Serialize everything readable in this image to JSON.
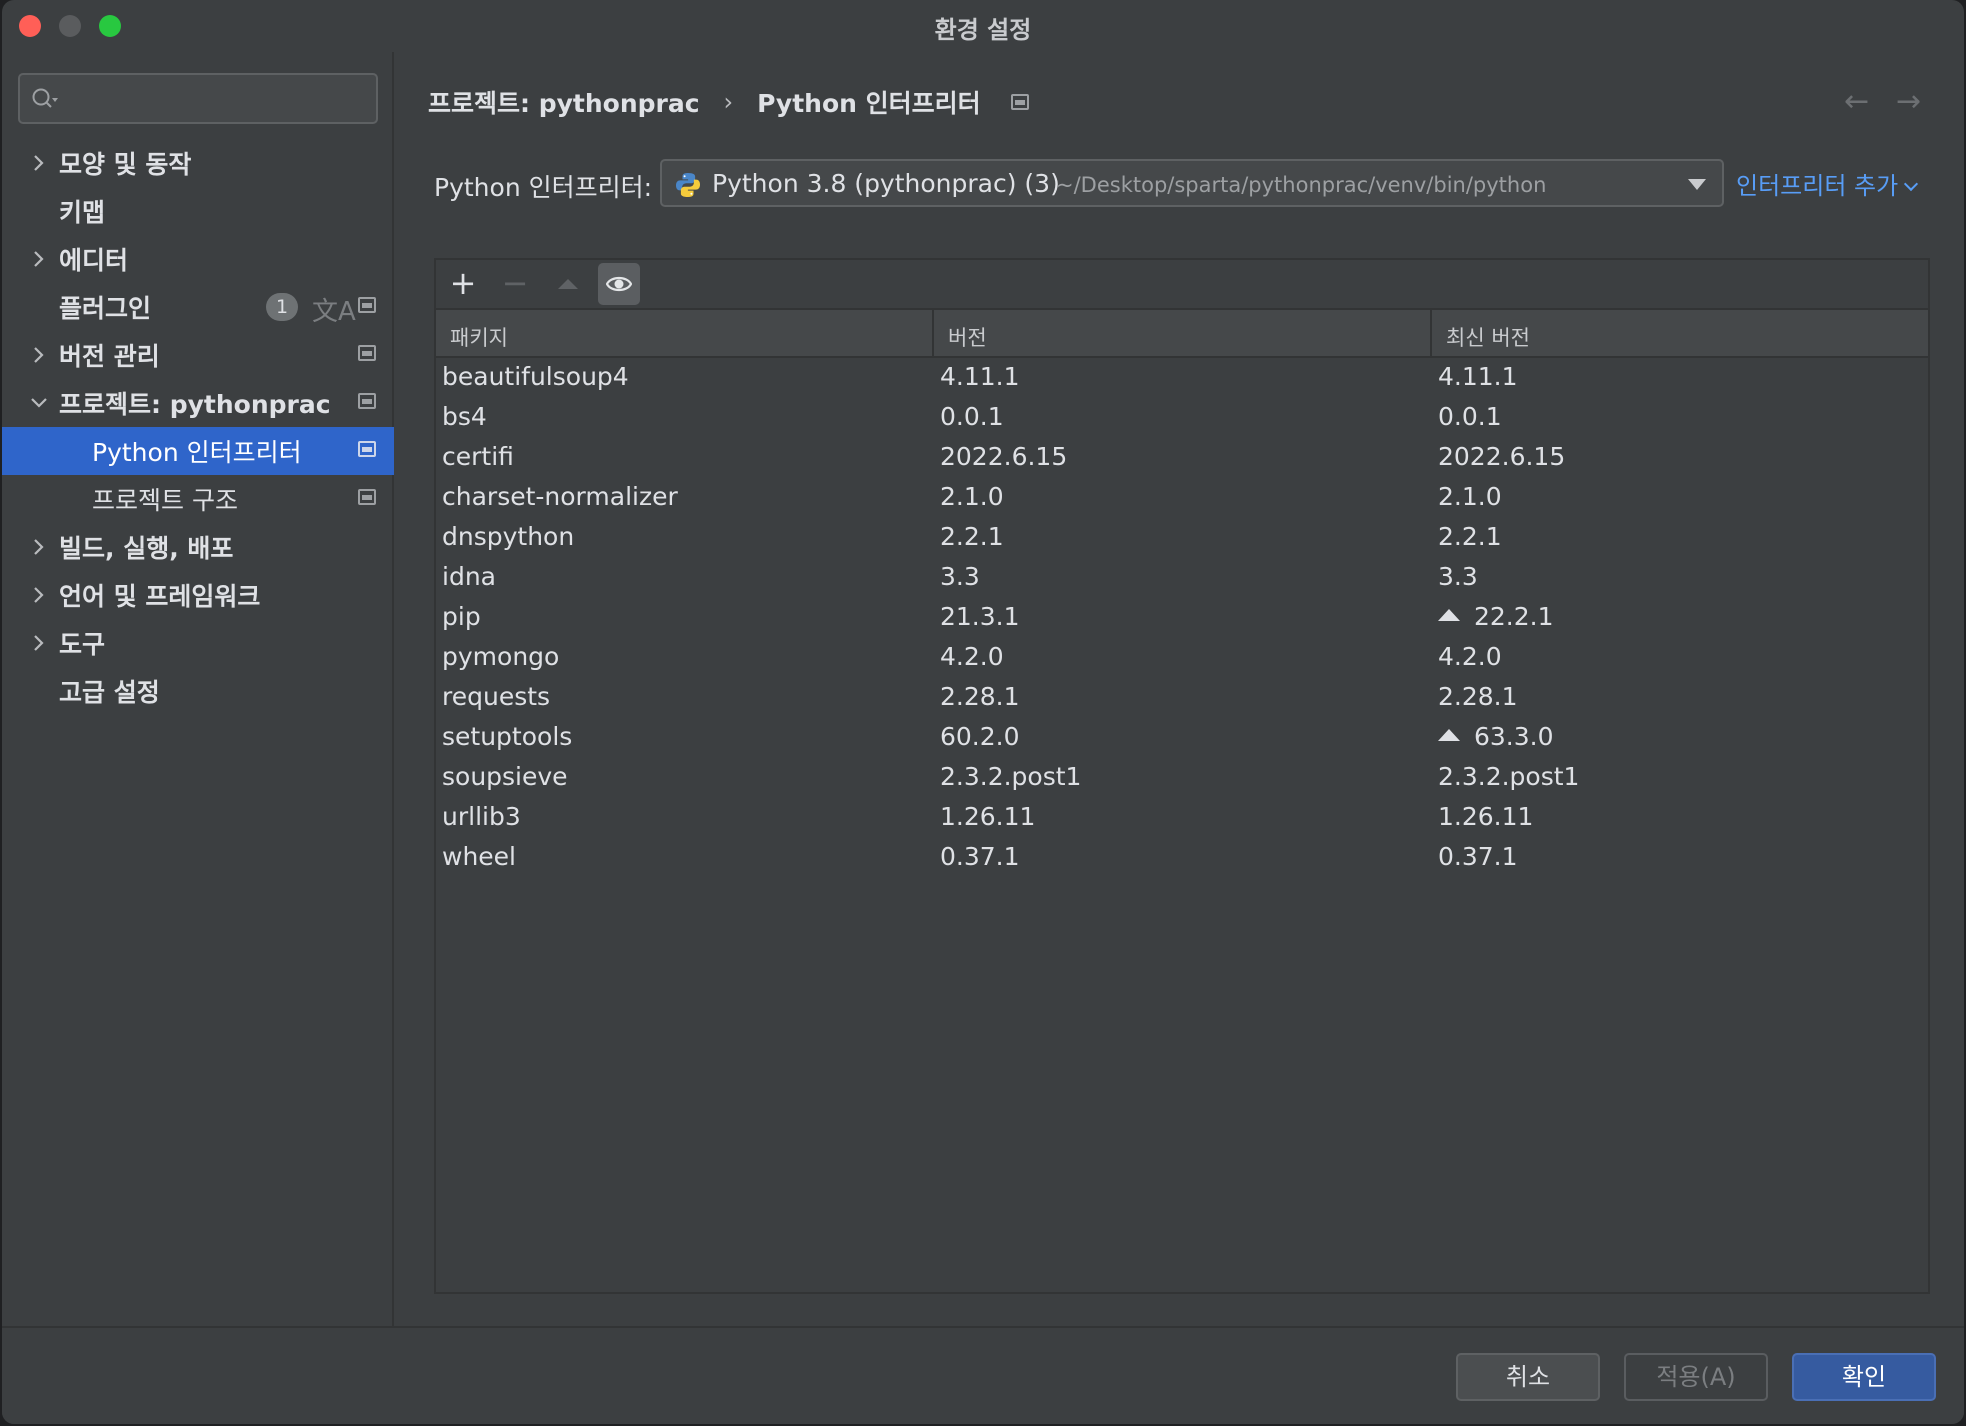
{
  "window": {
    "title": "환경 설정"
  },
  "sidebar": {
    "search_placeholder": "",
    "items": [
      {
        "label": "모양 및 동작",
        "chevron": "right"
      },
      {
        "label": "키맵"
      },
      {
        "label": "에디터",
        "chevron": "right"
      },
      {
        "label": "플러그인",
        "badge": "1"
      },
      {
        "label": "버전 관리",
        "chevron": "right"
      },
      {
        "label": "프로젝트: pythonprac",
        "chevron": "down"
      },
      {
        "label": "Python 인터프리터",
        "selected": true
      },
      {
        "label": "프로젝트 구조"
      },
      {
        "label": "빌드, 실행, 배포",
        "chevron": "right"
      },
      {
        "label": "언어 및 프레임워크",
        "chevron": "right"
      },
      {
        "label": "도구",
        "chevron": "right"
      },
      {
        "label": "고급 설정"
      }
    ],
    "help_label": "?"
  },
  "main": {
    "breadcrumb": {
      "project": "프로젝트: pythonprac",
      "sep": "›",
      "page": "Python 인터프리터"
    },
    "nav": {
      "back": "←",
      "forward": "→"
    },
    "interpreter_label": "Python 인터프리터:",
    "interpreter_name": "Python 3.8 (pythonprac) (3)",
    "interpreter_path": "~/Desktop/sparta/pythonprac/venv/bin/python",
    "add_interpreter": "인터프리터 추가",
    "toolbar": {
      "add": "+",
      "remove": "−"
    },
    "table": {
      "headers": [
        "패키지",
        "버전",
        "최신 버전"
      ],
      "rows": [
        {
          "package": "beautifulsoup4",
          "version": "4.11.1",
          "latest": "4.11.1",
          "upgrade": false
        },
        {
          "package": "bs4",
          "version": "0.0.1",
          "latest": "0.0.1",
          "upgrade": false
        },
        {
          "package": "certifi",
          "version": "2022.6.15",
          "latest": "2022.6.15",
          "upgrade": false
        },
        {
          "package": "charset-normalizer",
          "version": "2.1.0",
          "latest": "2.1.0",
          "upgrade": false
        },
        {
          "package": "dnspython",
          "version": "2.2.1",
          "latest": "2.2.1",
          "upgrade": false
        },
        {
          "package": "idna",
          "version": "3.3",
          "latest": "3.3",
          "upgrade": false
        },
        {
          "package": "pip",
          "version": "21.3.1",
          "latest": "22.2.1",
          "upgrade": true
        },
        {
          "package": "pymongo",
          "version": "4.2.0",
          "latest": "4.2.0",
          "upgrade": false
        },
        {
          "package": "requests",
          "version": "2.28.1",
          "latest": "2.28.1",
          "upgrade": false
        },
        {
          "package": "setuptools",
          "version": "60.2.0",
          "latest": "63.3.0",
          "upgrade": true
        },
        {
          "package": "soupsieve",
          "version": "2.3.2.post1",
          "latest": "2.3.2.post1",
          "upgrade": false
        },
        {
          "package": "urllib3",
          "version": "1.26.11",
          "latest": "1.26.11",
          "upgrade": false
        },
        {
          "package": "wheel",
          "version": "0.37.1",
          "latest": "0.37.1",
          "upgrade": false
        }
      ]
    }
  },
  "footer": {
    "cancel": "취소",
    "apply": "적용(A)",
    "ok": "확인"
  },
  "colors": {
    "accent": "#2f65ca",
    "link": "#589df6",
    "background": "#3c3f41"
  }
}
